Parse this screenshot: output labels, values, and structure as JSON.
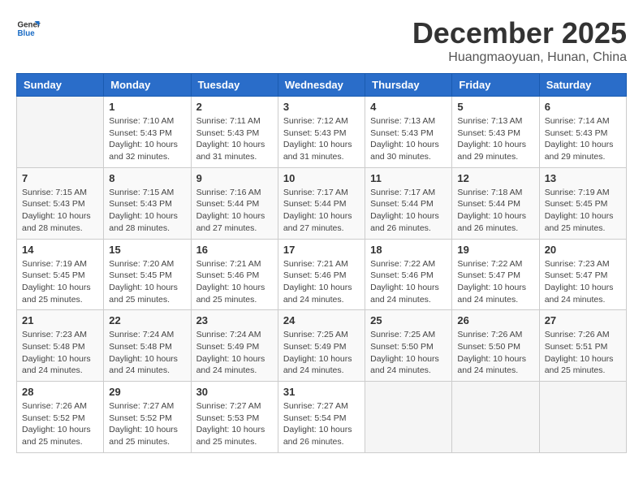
{
  "header": {
    "logo_general": "General",
    "logo_blue": "Blue",
    "month_year": "December 2025",
    "location": "Huangmaoyuan, Hunan, China"
  },
  "days_of_week": [
    "Sunday",
    "Monday",
    "Tuesday",
    "Wednesday",
    "Thursday",
    "Friday",
    "Saturday"
  ],
  "weeks": [
    [
      {
        "day": "",
        "info": ""
      },
      {
        "day": "1",
        "info": "Sunrise: 7:10 AM\nSunset: 5:43 PM\nDaylight: 10 hours\nand 32 minutes."
      },
      {
        "day": "2",
        "info": "Sunrise: 7:11 AM\nSunset: 5:43 PM\nDaylight: 10 hours\nand 31 minutes."
      },
      {
        "day": "3",
        "info": "Sunrise: 7:12 AM\nSunset: 5:43 PM\nDaylight: 10 hours\nand 31 minutes."
      },
      {
        "day": "4",
        "info": "Sunrise: 7:13 AM\nSunset: 5:43 PM\nDaylight: 10 hours\nand 30 minutes."
      },
      {
        "day": "5",
        "info": "Sunrise: 7:13 AM\nSunset: 5:43 PM\nDaylight: 10 hours\nand 29 minutes."
      },
      {
        "day": "6",
        "info": "Sunrise: 7:14 AM\nSunset: 5:43 PM\nDaylight: 10 hours\nand 29 minutes."
      }
    ],
    [
      {
        "day": "7",
        "info": "Sunrise: 7:15 AM\nSunset: 5:43 PM\nDaylight: 10 hours\nand 28 minutes."
      },
      {
        "day": "8",
        "info": "Sunrise: 7:15 AM\nSunset: 5:43 PM\nDaylight: 10 hours\nand 28 minutes."
      },
      {
        "day": "9",
        "info": "Sunrise: 7:16 AM\nSunset: 5:44 PM\nDaylight: 10 hours\nand 27 minutes."
      },
      {
        "day": "10",
        "info": "Sunrise: 7:17 AM\nSunset: 5:44 PM\nDaylight: 10 hours\nand 27 minutes."
      },
      {
        "day": "11",
        "info": "Sunrise: 7:17 AM\nSunset: 5:44 PM\nDaylight: 10 hours\nand 26 minutes."
      },
      {
        "day": "12",
        "info": "Sunrise: 7:18 AM\nSunset: 5:44 PM\nDaylight: 10 hours\nand 26 minutes."
      },
      {
        "day": "13",
        "info": "Sunrise: 7:19 AM\nSunset: 5:45 PM\nDaylight: 10 hours\nand 25 minutes."
      }
    ],
    [
      {
        "day": "14",
        "info": "Sunrise: 7:19 AM\nSunset: 5:45 PM\nDaylight: 10 hours\nand 25 minutes."
      },
      {
        "day": "15",
        "info": "Sunrise: 7:20 AM\nSunset: 5:45 PM\nDaylight: 10 hours\nand 25 minutes."
      },
      {
        "day": "16",
        "info": "Sunrise: 7:21 AM\nSunset: 5:46 PM\nDaylight: 10 hours\nand 25 minutes."
      },
      {
        "day": "17",
        "info": "Sunrise: 7:21 AM\nSunset: 5:46 PM\nDaylight: 10 hours\nand 24 minutes."
      },
      {
        "day": "18",
        "info": "Sunrise: 7:22 AM\nSunset: 5:46 PM\nDaylight: 10 hours\nand 24 minutes."
      },
      {
        "day": "19",
        "info": "Sunrise: 7:22 AM\nSunset: 5:47 PM\nDaylight: 10 hours\nand 24 minutes."
      },
      {
        "day": "20",
        "info": "Sunrise: 7:23 AM\nSunset: 5:47 PM\nDaylight: 10 hours\nand 24 minutes."
      }
    ],
    [
      {
        "day": "21",
        "info": "Sunrise: 7:23 AM\nSunset: 5:48 PM\nDaylight: 10 hours\nand 24 minutes."
      },
      {
        "day": "22",
        "info": "Sunrise: 7:24 AM\nSunset: 5:48 PM\nDaylight: 10 hours\nand 24 minutes."
      },
      {
        "day": "23",
        "info": "Sunrise: 7:24 AM\nSunset: 5:49 PM\nDaylight: 10 hours\nand 24 minutes."
      },
      {
        "day": "24",
        "info": "Sunrise: 7:25 AM\nSunset: 5:49 PM\nDaylight: 10 hours\nand 24 minutes."
      },
      {
        "day": "25",
        "info": "Sunrise: 7:25 AM\nSunset: 5:50 PM\nDaylight: 10 hours\nand 24 minutes."
      },
      {
        "day": "26",
        "info": "Sunrise: 7:26 AM\nSunset: 5:50 PM\nDaylight: 10 hours\nand 24 minutes."
      },
      {
        "day": "27",
        "info": "Sunrise: 7:26 AM\nSunset: 5:51 PM\nDaylight: 10 hours\nand 25 minutes."
      }
    ],
    [
      {
        "day": "28",
        "info": "Sunrise: 7:26 AM\nSunset: 5:52 PM\nDaylight: 10 hours\nand 25 minutes."
      },
      {
        "day": "29",
        "info": "Sunrise: 7:27 AM\nSunset: 5:52 PM\nDaylight: 10 hours\nand 25 minutes."
      },
      {
        "day": "30",
        "info": "Sunrise: 7:27 AM\nSunset: 5:53 PM\nDaylight: 10 hours\nand 25 minutes."
      },
      {
        "day": "31",
        "info": "Sunrise: 7:27 AM\nSunset: 5:54 PM\nDaylight: 10 hours\nand 26 minutes."
      },
      {
        "day": "",
        "info": ""
      },
      {
        "day": "",
        "info": ""
      },
      {
        "day": "",
        "info": ""
      }
    ]
  ]
}
